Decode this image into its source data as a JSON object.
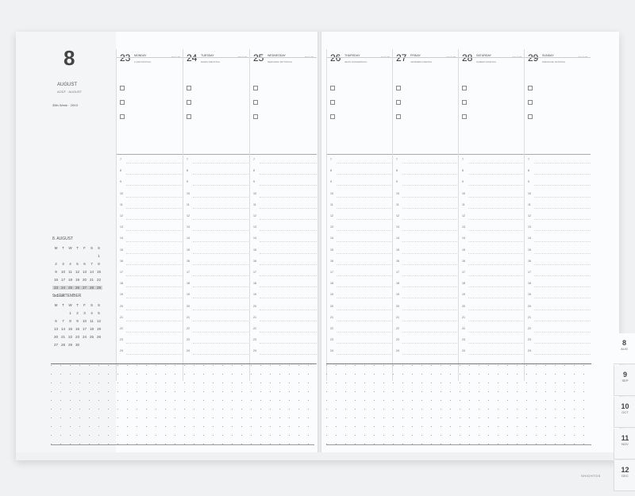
{
  "month": {
    "number": "8",
    "name": "AUGUST",
    "sub": "AOÛT · AUGUST",
    "week_label": "35th Week · 20XX"
  },
  "left_days": [
    {
      "num": "23",
      "name": "MONDAY",
      "sub": "LUNDI  MONTAG",
      "meta": "32/\n©:15"
    },
    {
      "num": "24",
      "name": "TUESDAY",
      "sub": "MARDI  DIENSTAG",
      "meta": "32/\n©:15"
    },
    {
      "num": "25",
      "name": "WEDNESDAY",
      "sub": "MERCREDI  MITTWOCH",
      "meta": "32/\n©:15"
    }
  ],
  "right_days": [
    {
      "num": "26",
      "name": "THURSDAY",
      "sub": "JEUDI  DONNERSTAG",
      "meta": "31/\n©:15"
    },
    {
      "num": "27",
      "name": "FRIDAY",
      "sub": "VENDREDI  FREITAG",
      "meta": "31/\n©:15"
    },
    {
      "num": "28",
      "name": "SATURDAY",
      "sub": "SAMEDI  SAMSTAG",
      "meta": "31/\n©:15"
    },
    {
      "num": "29",
      "name": "SUNDAY",
      "sub": "DIMANCHE  SONNTAG",
      "meta": "31/\n©:15"
    }
  ],
  "hours": [
    "7",
    "8",
    "9",
    "10",
    "11",
    "12",
    "13",
    "14",
    "15",
    "16",
    "17",
    "18",
    "19",
    "20",
    "21",
    "22",
    "23",
    "24"
  ],
  "mini_calendars": [
    {
      "title": "8. AUGUST",
      "weekdays": [
        "M",
        "T",
        "W",
        "T",
        "F",
        "S",
        "S"
      ],
      "rows": [
        [
          "",
          "",
          "",
          "",
          "",
          "",
          "1"
        ],
        [
          "2",
          "3",
          "4",
          "5",
          "6",
          "7",
          "8"
        ],
        [
          "9",
          "10",
          "11",
          "12",
          "13",
          "14",
          "15"
        ],
        [
          "16",
          "17",
          "18",
          "19",
          "20",
          "21",
          "22"
        ],
        [
          "23",
          "24",
          "25",
          "26",
          "27",
          "28",
          "29"
        ],
        [
          "30",
          "31",
          "",
          "",
          "",
          "",
          ""
        ]
      ]
    },
    {
      "title": "9. SEPTEMBER",
      "weekdays": [
        "M",
        "T",
        "W",
        "T",
        "F",
        "S",
        "S"
      ],
      "rows": [
        [
          "",
          "",
          "1",
          "2",
          "3",
          "4",
          "5"
        ],
        [
          "6",
          "7",
          "8",
          "9",
          "10",
          "11",
          "12"
        ],
        [
          "13",
          "14",
          "15",
          "16",
          "17",
          "18",
          "19"
        ],
        [
          "20",
          "21",
          "22",
          "23",
          "24",
          "25",
          "26"
        ],
        [
          "27",
          "28",
          "29",
          "30",
          "",
          "",
          ""
        ]
      ]
    }
  ],
  "tabs": [
    {
      "num": "8",
      "label": "AUG"
    },
    {
      "num": "9",
      "label": "SEP"
    },
    {
      "num": "10",
      "label": "OCT"
    },
    {
      "num": "11",
      "label": "NOV"
    },
    {
      "num": "12",
      "label": "DEC"
    }
  ],
  "brand": "SHIGHTOS",
  "colors": {
    "page": "#fbfcfd",
    "sidebar": "#f4f5f6",
    "highlight": "#d2d4d6",
    "background": "#f0f1f2"
  }
}
